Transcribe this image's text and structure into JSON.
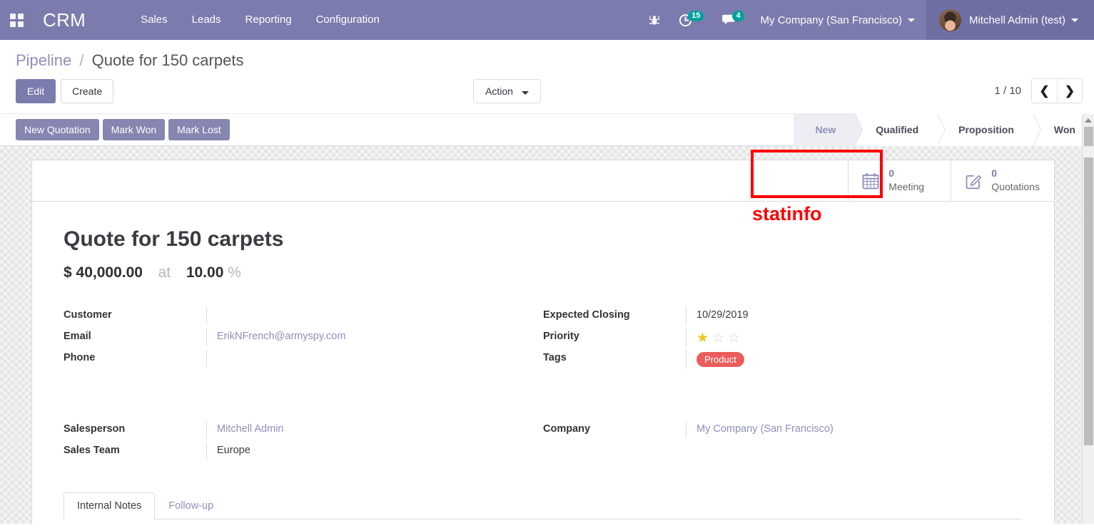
{
  "navbar": {
    "apps_icon": "apps-grid-icon",
    "brand": "CRM",
    "menu": [
      {
        "label": "Sales"
      },
      {
        "label": "Leads"
      },
      {
        "label": "Reporting"
      },
      {
        "label": "Configuration"
      }
    ],
    "bug_icon": "bug-icon",
    "activity_icon": "clock-activity-icon",
    "activity_count": "15",
    "messages_icon": "chat-bubble-icon",
    "messages_count": "4",
    "company": "My Company (San Francisco)",
    "user": "Mitchell Admin (test)",
    "colors": {
      "navbar_bg": "#7c7bad",
      "user_bg": "#6f6ea3",
      "badge_bg": "#00a09d"
    }
  },
  "control_panel": {
    "breadcrumb": {
      "root": "Pipeline",
      "separator": "/",
      "current": "Quote for 150 carpets"
    },
    "edit_label": "Edit",
    "create_label": "Create",
    "action_label": "Action",
    "pager": {
      "count": "1 / 10",
      "prev_icon": "chevron-left-icon",
      "next_icon": "chevron-right-icon"
    }
  },
  "statusbar": {
    "buttons": [
      {
        "label": "New Quotation"
      },
      {
        "label": "Mark Won"
      },
      {
        "label": "Mark Lost"
      }
    ],
    "stages": [
      {
        "label": "New",
        "active": true
      },
      {
        "label": "Qualified",
        "active": false
      },
      {
        "label": "Proposition",
        "active": false
      },
      {
        "label": "Won",
        "active": false
      }
    ]
  },
  "record": {
    "stat_buttons": [
      {
        "icon": "calendar-icon",
        "value": "0",
        "label": "Meeting"
      },
      {
        "icon": "pencil-square-icon",
        "value": "0",
        "label": "Quotations"
      }
    ],
    "title": "Quote for 150 carpets",
    "amount": "$ 40,000.00",
    "amount_connector": "at",
    "probability": "10.00",
    "probability_unit": "%",
    "fields_left": [
      {
        "label": "Customer",
        "value": "",
        "type": "text"
      },
      {
        "label": "Email",
        "value": "ErikNFrench@armyspy.com",
        "type": "link"
      },
      {
        "label": "Phone",
        "value": "",
        "type": "text"
      }
    ],
    "fields_right": [
      {
        "label": "Expected Closing",
        "value": "10/29/2019",
        "type": "text"
      },
      {
        "label": "Priority",
        "value": "",
        "type": "stars",
        "stars_total": 3,
        "stars_filled": 1
      },
      {
        "label": "Tags",
        "value": "Product",
        "type": "tag"
      }
    ],
    "fields_left2": [
      {
        "label": "Salesperson",
        "value": "Mitchell Admin",
        "type": "link"
      },
      {
        "label": "Sales Team",
        "value": "Europe",
        "type": "text"
      }
    ],
    "fields_right2": [
      {
        "label": "Company",
        "value": "My Company (San Francisco)",
        "type": "link"
      }
    ],
    "tabs": [
      {
        "label": "Internal Notes",
        "active": true
      },
      {
        "label": "Follow-up",
        "active": false
      }
    ]
  },
  "annotation": {
    "label": "statinfo",
    "color": "#ff0000"
  }
}
